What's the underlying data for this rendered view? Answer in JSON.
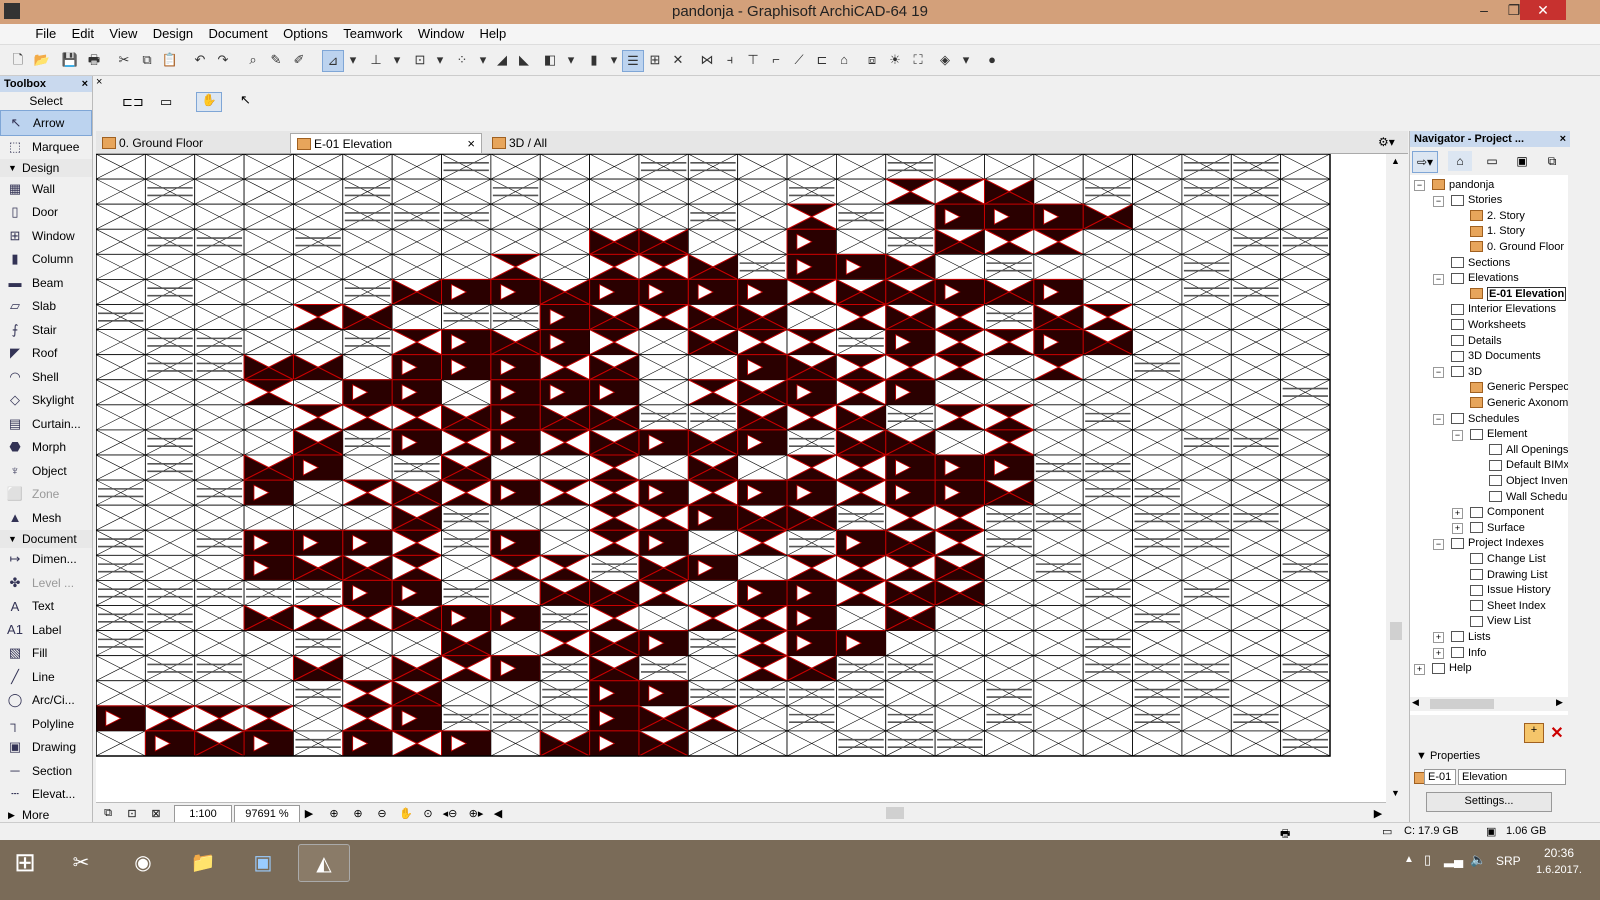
{
  "window": {
    "title": "pandonja - Graphisoft ArchiCAD-64 19",
    "minimize": "–",
    "restore": "❐",
    "close": "✕"
  },
  "menubar": [
    "File",
    "Edit",
    "View",
    "Design",
    "Document",
    "Options",
    "Teamwork",
    "Window",
    "Help"
  ],
  "toolbox": {
    "title": "Toolbox",
    "close": "×",
    "select_label": "Select",
    "select_items": [
      {
        "label": "Arrow",
        "icon": "arrow-icon",
        "glyph": "↖"
      },
      {
        "label": "Marquee",
        "icon": "marquee-icon",
        "glyph": "⬚"
      }
    ],
    "design_group": "Design",
    "design_items": [
      {
        "label": "Wall",
        "icon": "wall-icon",
        "glyph": "▦"
      },
      {
        "label": "Door",
        "icon": "door-icon",
        "glyph": "▯"
      },
      {
        "label": "Window",
        "icon": "window-icon",
        "glyph": "⊞"
      },
      {
        "label": "Column",
        "icon": "column-icon",
        "glyph": "▮"
      },
      {
        "label": "Beam",
        "icon": "beam-icon",
        "glyph": "▬"
      },
      {
        "label": "Slab",
        "icon": "slab-icon",
        "glyph": "▱"
      },
      {
        "label": "Stair",
        "icon": "stair-icon",
        "glyph": "⨍"
      },
      {
        "label": "Roof",
        "icon": "roof-icon",
        "glyph": "◤"
      },
      {
        "label": "Shell",
        "icon": "shell-icon",
        "glyph": "◠"
      },
      {
        "label": "Skylight",
        "icon": "skylight-icon",
        "glyph": "◇"
      },
      {
        "label": "Curtain...",
        "icon": "curtain-wall-icon",
        "glyph": "▤"
      },
      {
        "label": "Morph",
        "icon": "morph-icon",
        "glyph": "⬣"
      },
      {
        "label": "Object",
        "icon": "object-icon",
        "glyph": "♆"
      },
      {
        "label": "Zone",
        "icon": "zone-icon",
        "glyph": "⬜"
      },
      {
        "label": "Mesh",
        "icon": "mesh-icon",
        "glyph": "▲"
      }
    ],
    "document_group": "Document",
    "document_items": [
      {
        "label": "Dimen...",
        "icon": "dimension-icon",
        "glyph": "↦"
      },
      {
        "label": "Level ...",
        "icon": "level-dimension-icon",
        "glyph": "✤"
      },
      {
        "label": "Text",
        "icon": "text-icon",
        "glyph": "A"
      },
      {
        "label": "Label",
        "icon": "label-icon",
        "glyph": "A1"
      },
      {
        "label": "Fill",
        "icon": "fill-icon",
        "glyph": "▧"
      },
      {
        "label": "Line",
        "icon": "line-icon",
        "glyph": "╱"
      },
      {
        "label": "Arc/Ci...",
        "icon": "arc-circle-icon",
        "glyph": "◯"
      },
      {
        "label": "Polyline",
        "icon": "polyline-icon",
        "glyph": "┐"
      },
      {
        "label": "Drawing",
        "icon": "drawing-icon",
        "glyph": "▣"
      },
      {
        "label": "Section",
        "icon": "section-icon",
        "glyph": "─"
      },
      {
        "label": "Elevat...",
        "icon": "elevation-icon",
        "glyph": "┄"
      }
    ],
    "more": "More"
  },
  "tabs": [
    {
      "label": "0. Ground Floor",
      "icon": "floor-plan-tab-icon"
    },
    {
      "label": "E-01 Elevation",
      "icon": "elevation-tab-icon",
      "close": "×"
    },
    {
      "label": "3D / All",
      "icon": "3d-tab-icon"
    }
  ],
  "bottombar": {
    "scale": "1:100",
    "zoom": "97691 %"
  },
  "navigator": {
    "title": "Navigator - Project ...",
    "close": "×",
    "tree": [
      {
        "label": "pandonja",
        "level": 0,
        "exp": "−",
        "folder": true
      },
      {
        "label": "Stories",
        "level": 1,
        "exp": "−"
      },
      {
        "label": "2. Story",
        "level": 2,
        "folder": true
      },
      {
        "label": "1. Story",
        "level": 2,
        "folder": true
      },
      {
        "label": "0. Ground Floor",
        "level": 2,
        "folder": true
      },
      {
        "label": "Sections",
        "level": 1
      },
      {
        "label": "Elevations",
        "level": 1,
        "exp": "−"
      },
      {
        "label": "E-01 Elevation",
        "level": 2,
        "folder": true,
        "selected": true
      },
      {
        "label": "Interior Elevations",
        "level": 1
      },
      {
        "label": "Worksheets",
        "level": 1
      },
      {
        "label": "Details",
        "level": 1
      },
      {
        "label": "3D Documents",
        "level": 1
      },
      {
        "label": "3D",
        "level": 1,
        "exp": "−"
      },
      {
        "label": "Generic Perspec",
        "level": 2,
        "folder": true
      },
      {
        "label": "Generic Axonom",
        "level": 2,
        "folder": true
      },
      {
        "label": "Schedules",
        "level": 1,
        "exp": "−"
      },
      {
        "label": "Element",
        "level": 2,
        "exp": "−"
      },
      {
        "label": "All Openings",
        "level": 3
      },
      {
        "label": "Default BIMx",
        "level": 3
      },
      {
        "label": "Object Inven",
        "level": 3
      },
      {
        "label": "Wall Schedu",
        "level": 3
      },
      {
        "label": "Component",
        "level": 2,
        "exp": "+"
      },
      {
        "label": "Surface",
        "level": 2,
        "exp": "+"
      },
      {
        "label": "Project Indexes",
        "level": 1,
        "exp": "−"
      },
      {
        "label": "Change List",
        "level": 2
      },
      {
        "label": "Drawing List",
        "level": 2
      },
      {
        "label": "Issue History",
        "level": 2
      },
      {
        "label": "Sheet Index",
        "level": 2
      },
      {
        "label": "View List",
        "level": 2
      },
      {
        "label": "Lists",
        "level": 1,
        "exp": "+"
      },
      {
        "label": "Info",
        "level": 1,
        "exp": "+"
      },
      {
        "label": "Help",
        "level": 0,
        "exp": "+"
      }
    ],
    "properties_label": "Properties",
    "prop_id": "E-01",
    "prop_name": "Elevation",
    "settings_label": "Settings..."
  },
  "status": {
    "disk": "C: 17.9 GB",
    "ram": "1.06 GB"
  },
  "taskbar": {
    "lang": "SRP",
    "time": "20:36",
    "date": "1.6.2017."
  },
  "colors": {
    "titlebar": "#d3a07a",
    "fill_dark": "#2a0000",
    "fill_red": "#c80000",
    "accent": "#bcd3ef"
  }
}
